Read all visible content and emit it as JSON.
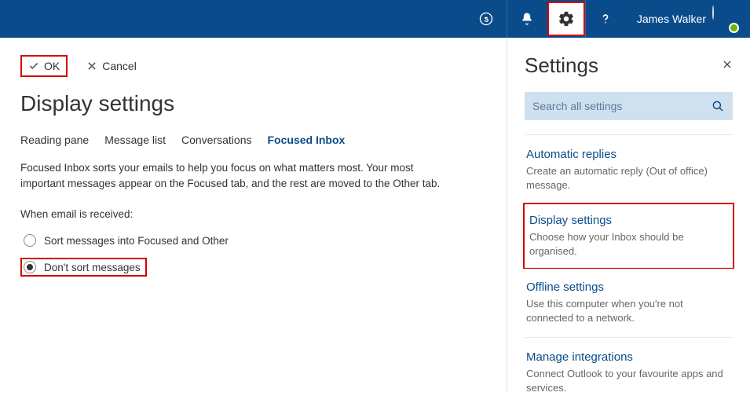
{
  "topbar": {
    "username": "James Walker"
  },
  "main": {
    "ok_label": "OK",
    "cancel_label": "Cancel",
    "heading": "Display settings",
    "tabs": [
      {
        "label": "Reading pane",
        "active": false
      },
      {
        "label": "Message list",
        "active": false
      },
      {
        "label": "Conversations",
        "active": false
      },
      {
        "label": "Focused Inbox",
        "active": true
      }
    ],
    "description": "Focused Inbox sorts your emails to help you focus on what matters most. Your most important messages appear on the Focused tab, and the rest are moved to the Other tab.",
    "received_label": "When email is received:",
    "options": [
      {
        "label": "Sort messages into Focused and Other",
        "checked": false,
        "highlight": false
      },
      {
        "label": "Don't sort messages",
        "checked": true,
        "highlight": true
      }
    ]
  },
  "side": {
    "title": "Settings",
    "search_placeholder": "Search all settings",
    "items": [
      {
        "title": "Automatic replies",
        "desc": "Create an automatic reply (Out of office) message.",
        "highlight": false
      },
      {
        "title": "Display settings",
        "desc": "Choose how your Inbox should be organised.",
        "highlight": true
      },
      {
        "title": "Offline settings",
        "desc": "Use this computer when you're not connected to a network.",
        "highlight": false
      },
      {
        "title": "Manage integrations",
        "desc": "Connect Outlook to your favourite apps and services.",
        "highlight": false
      }
    ]
  }
}
